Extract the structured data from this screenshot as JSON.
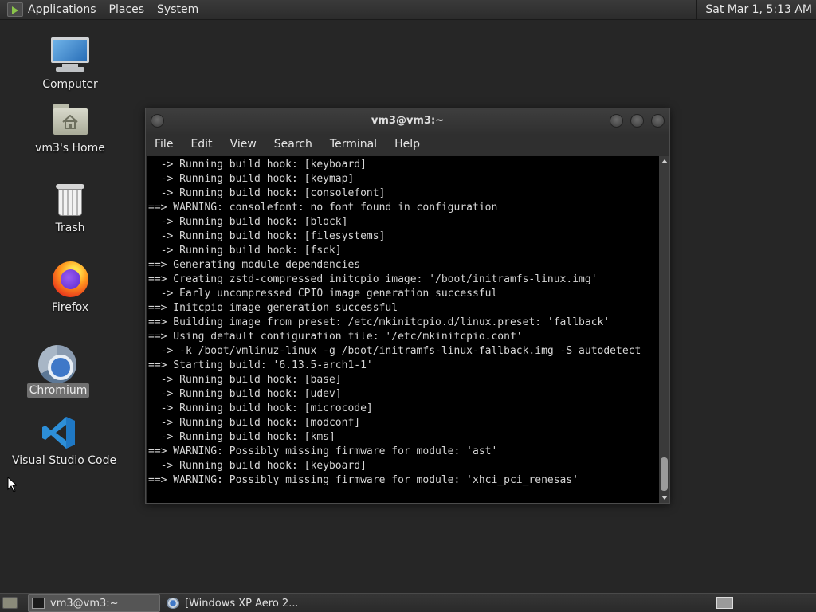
{
  "top_panel": {
    "menus": [
      "Applications",
      "Places",
      "System"
    ],
    "clock": "Sat Mar 1, 5:13 AM"
  },
  "desktop": {
    "icons": [
      {
        "label": "Computer",
        "icon": "computer-icon"
      },
      {
        "label": "vm3's Home",
        "icon": "home-folder-icon"
      },
      {
        "label": "Trash",
        "icon": "trash-icon"
      },
      {
        "label": "Firefox",
        "icon": "firefox-icon"
      },
      {
        "label": "Chromium",
        "icon": "chromium-icon",
        "selected": true
      },
      {
        "label": "Visual Studio Code",
        "icon": "vscode-icon"
      }
    ]
  },
  "terminal": {
    "title": "vm3@vm3:~",
    "menu": [
      "File",
      "Edit",
      "View",
      "Search",
      "Terminal",
      "Help"
    ],
    "lines": [
      "  -> Running build hook: [keyboard]",
      "  -> Running build hook: [keymap]",
      "  -> Running build hook: [consolefont]",
      "==> WARNING: consolefont: no font found in configuration",
      "  -> Running build hook: [block]",
      "  -> Running build hook: [filesystems]",
      "  -> Running build hook: [fsck]",
      "==> Generating module dependencies",
      "==> Creating zstd-compressed initcpio image: '/boot/initramfs-linux.img'",
      "  -> Early uncompressed CPIO image generation successful",
      "==> Initcpio image generation successful",
      "==> Building image from preset: /etc/mkinitcpio.d/linux.preset: 'fallback'",
      "==> Using default configuration file: '/etc/mkinitcpio.conf'",
      "  -> -k /boot/vmlinuz-linux -g /boot/initramfs-linux-fallback.img -S autodetect",
      "==> Starting build: '6.13.5-arch1-1'",
      "  -> Running build hook: [base]",
      "  -> Running build hook: [udev]",
      "  -> Running build hook: [microcode]",
      "  -> Running build hook: [modconf]",
      "  -> Running build hook: [kms]",
      "==> WARNING: Possibly missing firmware for module: 'ast'",
      "  -> Running build hook: [keyboard]",
      "==> WARNING: Possibly missing firmware for module: 'xhci_pci_renesas'"
    ]
  },
  "taskbar": {
    "tasks": [
      {
        "label": "vm3@vm3:~",
        "icon": "terminal-icon",
        "active": true
      },
      {
        "label": "[Windows XP Aero 2...",
        "icon": "chromium-icon",
        "active": false
      }
    ]
  },
  "colors": {
    "desktop_bg": "#262626",
    "terminal_bg": "#000000",
    "terminal_fg": "#d6d6d6",
    "panel_bg": "#2c2c2c"
  }
}
